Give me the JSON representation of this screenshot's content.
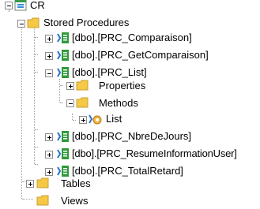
{
  "tree": {
    "root": {
      "label": "CR",
      "expanded": true
    },
    "stored_procedures": {
      "label": "Stored Procedures",
      "expanded": true
    },
    "procedures": [
      {
        "label": "[dbo].[PRC_Comparaison]",
        "expanded": false
      },
      {
        "label": "[dbo].[PRC_GetComparaison]",
        "expanded": false
      },
      {
        "label": "[dbo].[PRC_List]",
        "expanded": true
      },
      {
        "label": "[dbo].[PRC_NbreDeJours]",
        "expanded": false
      },
      {
        "label": "[dbo].[PRC_ResumeInformationUser]",
        "expanded": false
      },
      {
        "label": "[dbo].[PRC_TotalRetard]",
        "expanded": false
      }
    ],
    "prc_list_children": {
      "properties": {
        "label": "Properties",
        "expanded": false
      },
      "methods": {
        "label": "Methods",
        "expanded": true
      },
      "methods_children": [
        {
          "label": "List",
          "expanded": false
        }
      ]
    },
    "tables": {
      "label": "Tables",
      "expanded": false
    },
    "views": {
      "label": "Views"
    }
  },
  "icons": {
    "database": "database-icon",
    "folder": "folder-icon",
    "procedure": "stored-procedure-icon",
    "method": "method-icon"
  },
  "colors": {
    "folder": "#f5c845",
    "procedure_green": "#2e9a3a",
    "procedure_blue": "#2b6fcf"
  }
}
